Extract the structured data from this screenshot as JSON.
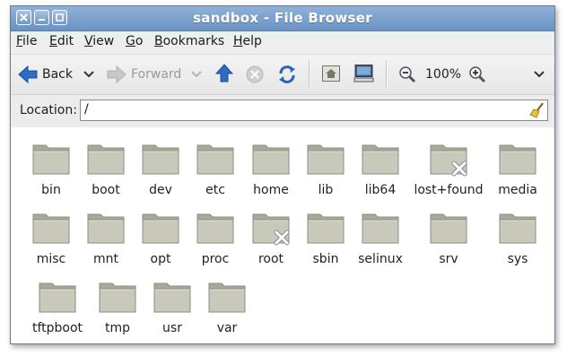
{
  "window": {
    "title": "sandbox - File Browser"
  },
  "menubar": {
    "items": [
      {
        "key": "F",
        "rest": "ile"
      },
      {
        "key": "E",
        "rest": "dit"
      },
      {
        "key": "V",
        "rest": "iew"
      },
      {
        "key": "G",
        "rest": "o"
      },
      {
        "key": "B",
        "rest": "ookmarks"
      },
      {
        "key": "H",
        "rest": "elp"
      }
    ]
  },
  "toolbar": {
    "back_label": "Back",
    "forward_label": "Forward",
    "zoom_level": "100%"
  },
  "location": {
    "label": "Location:",
    "value": "/"
  },
  "files": [
    {
      "name": "bin"
    },
    {
      "name": "boot"
    },
    {
      "name": "dev"
    },
    {
      "name": "etc"
    },
    {
      "name": "home"
    },
    {
      "name": "lib"
    },
    {
      "name": "lib64"
    },
    {
      "name": "lost+found"
    },
    {
      "name": "media"
    },
    {
      "name": "misc"
    },
    {
      "name": "mnt"
    },
    {
      "name": "opt"
    },
    {
      "name": "proc"
    },
    {
      "name": "root"
    },
    {
      "name": "sbin"
    },
    {
      "name": "selinux"
    },
    {
      "name": "srv"
    },
    {
      "name": "sys"
    },
    {
      "name": "tftpboot"
    },
    {
      "name": "tmp"
    },
    {
      "name": "usr"
    },
    {
      "name": "var"
    }
  ],
  "colors": {
    "titlebar": "#7aa0cf",
    "folder": "#c9c9bb",
    "locked_badge": "#ffffff"
  }
}
